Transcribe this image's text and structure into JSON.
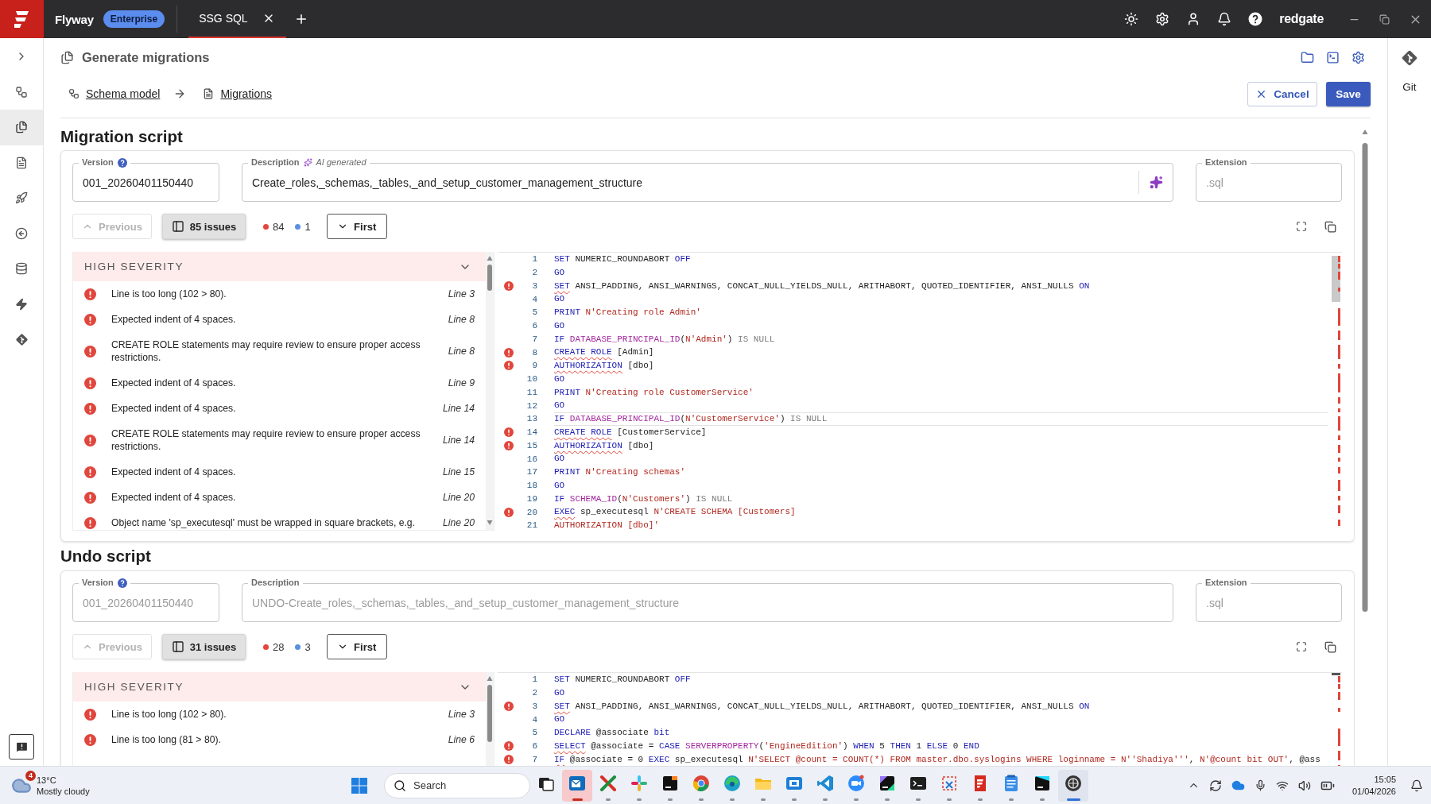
{
  "title_bar": {
    "product": "Flyway",
    "edition": "Enterprise",
    "tabs": [
      {
        "label": "SSG SQL",
        "selected": true
      }
    ],
    "brand": "redgate"
  },
  "nav": [
    {
      "kind": "expand",
      "selected": false
    },
    {
      "kind": "schema",
      "selected": false
    },
    {
      "kind": "migrations",
      "selected": true
    },
    {
      "kind": "document",
      "selected": false
    },
    {
      "kind": "deploy",
      "selected": false
    },
    {
      "kind": "undo",
      "selected": false
    },
    {
      "kind": "database",
      "selected": false
    },
    {
      "kind": "bolt",
      "selected": false
    },
    {
      "kind": "git",
      "selected": false
    }
  ],
  "page": {
    "title": "Generate migrations",
    "breadcrumb": [
      {
        "kind": "schema",
        "label": "Schema model"
      },
      {
        "kind": "document",
        "label": "Migrations"
      }
    ],
    "cancel": "Cancel",
    "save": "Save"
  },
  "scripts": [
    {
      "title": "Migration script",
      "version": {
        "label": "Version",
        "value": "001_20260401150440",
        "disabled": false
      },
      "description": {
        "label": "Description",
        "note": "AI generated",
        "value": "Create_roles,_schemas,_tables,_and_setup_customer_management_structure",
        "disabled": false,
        "ai_button": true
      },
      "extension": {
        "label": "Extension",
        "value": ".sql",
        "disabled": true
      },
      "previous": {
        "label": "Previous",
        "disabled": true
      },
      "issues_toggle": {
        "label": "85 issues",
        "selected": true
      },
      "counts": [
        {
          "value": "84",
          "color": "#e5463c"
        },
        {
          "value": "1",
          "color": "#5b8fe0"
        }
      ],
      "first": {
        "label": "First"
      },
      "issue_group": {
        "title": "HIGH SEVERITY",
        "expanded": true,
        "issues": [
          {
            "message": "Line is too long (102 > 80).",
            "line": "Line 3"
          },
          {
            "message": "Expected indent of 4 spaces.",
            "line": "Line 8"
          },
          {
            "message": "CREATE ROLE statements may require review to ensure proper access restrictions.",
            "line": "Line 8"
          },
          {
            "message": "Expected indent of 4 spaces.",
            "line": "Line 9"
          },
          {
            "message": "Expected indent of 4 spaces.",
            "line": "Line 14"
          },
          {
            "message": "CREATE ROLE statements may require review to ensure proper access restrictions.",
            "line": "Line 14"
          },
          {
            "message": "Expected indent of 4 spaces.",
            "line": "Line 15"
          },
          {
            "message": "Expected indent of 4 spaces.",
            "line": "Line 20"
          },
          {
            "message": "Object name 'sp_executesql' must be wrapped in square brackets, e.g.",
            "line": "Line 20"
          }
        ]
      },
      "code": [
        {
          "number": "1",
          "error": false,
          "current": false,
          "tokens": [
            {
              "kind": "keyword",
              "text": "SET"
            },
            {
              "kind": "plain",
              "text": " NUMERIC_ROUNDABORT "
            },
            {
              "kind": "keyword",
              "text": "OFF"
            }
          ]
        },
        {
          "number": "2",
          "error": false,
          "current": false,
          "tokens": [
            {
              "kind": "keyword",
              "text": "GO"
            }
          ]
        },
        {
          "number": "3",
          "error": true,
          "current": false,
          "tokens": [
            {
              "kind": "keyword",
              "text": "SET"
            },
            {
              "kind": "plain",
              "text": " ANSI_PADDING, ANSI_WARNINGS, CONCAT_NULL_YIELDS_NULL, ARITHABORT, QUOTED_IDENTIFIER, ANSI_NULLS "
            },
            {
              "kind": "keyword",
              "text": "ON"
            }
          ]
        },
        {
          "number": "4",
          "error": false,
          "current": false,
          "tokens": [
            {
              "kind": "keyword",
              "text": "GO"
            }
          ]
        },
        {
          "number": "5",
          "error": false,
          "current": false,
          "tokens": [
            {
              "kind": "keyword",
              "text": "PRINT"
            },
            {
              "kind": "string",
              "text": " N'Creating role Admin'"
            }
          ]
        },
        {
          "number": "6",
          "error": false,
          "current": false,
          "tokens": [
            {
              "kind": "keyword",
              "text": "GO"
            }
          ]
        },
        {
          "number": "7",
          "error": false,
          "current": false,
          "tokens": [
            {
              "kind": "keyword",
              "text": "IF"
            },
            {
              "kind": "function",
              "text": " DATABASE_PRINCIPAL_ID"
            },
            {
              "kind": "plain",
              "text": "("
            },
            {
              "kind": "string",
              "text": "N'Admin'"
            },
            {
              "kind": "plain",
              "text": ") "
            },
            {
              "kind": "operator",
              "text": "IS NULL"
            }
          ]
        },
        {
          "number": "8",
          "error": true,
          "current": false,
          "tokens": [
            {
              "kind": "keyword",
              "text": "CREATE ROLE"
            },
            {
              "kind": "plain",
              "text": " [Admin]"
            }
          ]
        },
        {
          "number": "9",
          "error": true,
          "current": false,
          "tokens": [
            {
              "kind": "keyword",
              "text": "AUTHORIZATION"
            },
            {
              "kind": "plain",
              "text": " [dbo]"
            }
          ]
        },
        {
          "number": "10",
          "error": false,
          "current": false,
          "tokens": [
            {
              "kind": "keyword",
              "text": "GO"
            }
          ]
        },
        {
          "number": "11",
          "error": false,
          "current": false,
          "tokens": [
            {
              "kind": "keyword",
              "text": "PRINT"
            },
            {
              "kind": "string",
              "text": " N'Creating role CustomerService'"
            }
          ]
        },
        {
          "number": "12",
          "error": false,
          "current": false,
          "tokens": [
            {
              "kind": "keyword",
              "text": "GO"
            }
          ]
        },
        {
          "number": "13",
          "error": false,
          "current": true,
          "tokens": [
            {
              "kind": "keyword",
              "text": "IF"
            },
            {
              "kind": "function",
              "text": " DATABASE_PRINCIPAL_ID"
            },
            {
              "kind": "plain",
              "text": "("
            },
            {
              "kind": "string",
              "text": "N'CustomerService'"
            },
            {
              "kind": "plain",
              "text": ") "
            },
            {
              "kind": "operator",
              "text": "IS NULL"
            }
          ]
        },
        {
          "number": "14",
          "error": true,
          "current": false,
          "tokens": [
            {
              "kind": "keyword",
              "text": "CREATE ROLE"
            },
            {
              "kind": "plain",
              "text": " [CustomerService]"
            }
          ]
        },
        {
          "number": "15",
          "error": true,
          "current": false,
          "tokens": [
            {
              "kind": "keyword",
              "text": "AUTHORIZATION"
            },
            {
              "kind": "plain",
              "text": " [dbo]"
            }
          ]
        },
        {
          "number": "16",
          "error": false,
          "current": false,
          "tokens": [
            {
              "kind": "keyword",
              "text": "GO"
            }
          ]
        },
        {
          "number": "17",
          "error": false,
          "current": false,
          "tokens": [
            {
              "kind": "keyword",
              "text": "PRINT"
            },
            {
              "kind": "string",
              "text": " N'Creating schemas'"
            }
          ]
        },
        {
          "number": "18",
          "error": false,
          "current": false,
          "tokens": [
            {
              "kind": "keyword",
              "text": "GO"
            }
          ]
        },
        {
          "number": "19",
          "error": false,
          "current": false,
          "tokens": [
            {
              "kind": "keyword",
              "text": "IF"
            },
            {
              "kind": "function",
              "text": " SCHEMA_ID"
            },
            {
              "kind": "plain",
              "text": "("
            },
            {
              "kind": "string",
              "text": "N'Customers'"
            },
            {
              "kind": "plain",
              "text": ") "
            },
            {
              "kind": "operator",
              "text": "IS NULL"
            }
          ]
        },
        {
          "number": "20",
          "error": true,
          "current": false,
          "tokens": [
            {
              "kind": "keyword",
              "text": "EXEC"
            },
            {
              "kind": "plain",
              "text": " sp_executesql "
            },
            {
              "kind": "string",
              "text": "N'CREATE SCHEMA [Customers]"
            }
          ]
        },
        {
          "number": "21",
          "error": false,
          "current": false,
          "tokens": [
            {
              "kind": "string",
              "text": "AUTHORIZATION [dbo]'"
            }
          ]
        }
      ]
    },
    {
      "title": "Undo script",
      "version": {
        "label": "Version",
        "value": "001_20260401150440",
        "disabled": true
      },
      "description": {
        "label": "Description",
        "value": "UNDO-Create_roles,_schemas,_tables,_and_setup_customer_management_structure",
        "disabled": true,
        "ai_button": false
      },
      "extension": {
        "label": "Extension",
        "value": ".sql",
        "disabled": true
      },
      "previous": {
        "label": "Previous",
        "disabled": true
      },
      "issues_toggle": {
        "label": "31 issues",
        "selected": true
      },
      "counts": [
        {
          "value": "28",
          "color": "#e5463c"
        },
        {
          "value": "3",
          "color": "#5b8fe0"
        }
      ],
      "first": {
        "label": "First"
      },
      "issue_group": {
        "title": "HIGH SEVERITY",
        "expanded": true,
        "issues": [
          {
            "message": "Line is too long (102 > 80).",
            "line": "Line 3"
          },
          {
            "message": "Line is too long (81 > 80).",
            "line": "Line 6"
          }
        ]
      },
      "code": [
        {
          "number": "1",
          "error": false,
          "current": false,
          "tokens": [
            {
              "kind": "keyword",
              "text": "SET"
            },
            {
              "kind": "plain",
              "text": " NUMERIC_ROUNDABORT "
            },
            {
              "kind": "keyword",
              "text": "OFF"
            }
          ]
        },
        {
          "number": "2",
          "error": false,
          "current": false,
          "tokens": [
            {
              "kind": "keyword",
              "text": "GO"
            }
          ]
        },
        {
          "number": "3",
          "error": true,
          "current": false,
          "tokens": [
            {
              "kind": "keyword",
              "text": "SET"
            },
            {
              "kind": "plain",
              "text": " ANSI_PADDING, ANSI_WARNINGS, CONCAT_NULL_YIELDS_NULL, ARITHABORT, QUOTED_IDENTIFIER, ANSI_NULLS "
            },
            {
              "kind": "keyword",
              "text": "ON"
            }
          ]
        },
        {
          "number": "4",
          "error": false,
          "current": false,
          "tokens": [
            {
              "kind": "keyword",
              "text": "GO"
            }
          ]
        },
        {
          "number": "5",
          "error": false,
          "current": false,
          "tokens": [
            {
              "kind": "keyword",
              "text": "DECLARE"
            },
            {
              "kind": "plain",
              "text": " @associate "
            },
            {
              "kind": "keyword",
              "text": "bit"
            }
          ]
        },
        {
          "number": "6",
          "error": true,
          "current": false,
          "tokens": [
            {
              "kind": "keyword",
              "text": "SELECT"
            },
            {
              "kind": "plain",
              "text": " @associate = "
            },
            {
              "kind": "keyword",
              "text": "CASE"
            },
            {
              "kind": "function",
              "text": " SERVERPROPERTY"
            },
            {
              "kind": "plain",
              "text": "("
            },
            {
              "kind": "string",
              "text": "'EngineEdition'"
            },
            {
              "kind": "plain",
              "text": ") "
            },
            {
              "kind": "keyword",
              "text": "WHEN"
            },
            {
              "kind": "plain",
              "text": " 5 "
            },
            {
              "kind": "keyword",
              "text": "THEN"
            },
            {
              "kind": "plain",
              "text": " 1 "
            },
            {
              "kind": "keyword",
              "text": "ELSE"
            },
            {
              "kind": "plain",
              "text": " 0 "
            },
            {
              "kind": "keyword",
              "text": "END"
            }
          ]
        },
        {
          "number": "7",
          "error": true,
          "current": false,
          "tokens": [
            {
              "kind": "keyword",
              "text": "IF"
            },
            {
              "kind": "plain",
              "text": " @associate = 0 "
            },
            {
              "kind": "keyword",
              "text": "EXEC"
            },
            {
              "kind": "plain",
              "text": " sp_executesql "
            },
            {
              "kind": "string",
              "text": "N'SELECT @count = COUNT(*) FROM master.dbo.syslogins WHERE loginname = N''Shadiya'''"
            },
            {
              "kind": "plain",
              "text": ", "
            },
            {
              "kind": "string",
              "text": "N'@count bit OUT'"
            },
            {
              "kind": "plain",
              "text": ", @ass"
            }
          ]
        }
      ]
    }
  ],
  "right_rail": {
    "label": "Git"
  },
  "taskbar": {
    "weather": {
      "badge": "4",
      "temperature": "13°C",
      "condition": "Mostly cloudy"
    },
    "search": {
      "placeholder": "Search"
    },
    "apps": [
      {
        "kind": "taskview",
        "running": false,
        "selected": false,
        "alert": false
      },
      {
        "kind": "mail",
        "running": true,
        "selected": false,
        "alert": true
      },
      {
        "kind": "cross",
        "running": true,
        "selected": false,
        "alert": false
      },
      {
        "kind": "pinwheel",
        "running": true,
        "selected": false,
        "alert": false
      },
      {
        "kind": "ide",
        "running": true,
        "selected": false,
        "alert": false
      },
      {
        "kind": "browser",
        "running": true,
        "selected": false,
        "alert": false
      },
      {
        "kind": "swirl",
        "running": true,
        "selected": false,
        "alert": false
      },
      {
        "kind": "folder",
        "running": true,
        "selected": false,
        "alert": false
      },
      {
        "kind": "remote",
        "running": true,
        "selected": false,
        "alert": false
      },
      {
        "kind": "code",
        "running": true,
        "selected": false,
        "alert": false
      },
      {
        "kind": "video",
        "running": true,
        "selected": false,
        "alert": false
      },
      {
        "kind": "dbide",
        "running": true,
        "selected": false,
        "alert": false
      },
      {
        "kind": "terminal",
        "running": true,
        "selected": false,
        "alert": false
      },
      {
        "kind": "snip",
        "running": true,
        "selected": false,
        "alert": false
      },
      {
        "kind": "page",
        "running": true,
        "selected": false,
        "alert": false
      },
      {
        "kind": "notepad",
        "running": true,
        "selected": false,
        "alert": false
      },
      {
        "kind": "webide",
        "running": true,
        "selected": false,
        "alert": false
      },
      {
        "kind": "orb",
        "running": true,
        "selected": true,
        "alert": false
      }
    ],
    "time": "15:05",
    "date": "01/04/2026"
  }
}
